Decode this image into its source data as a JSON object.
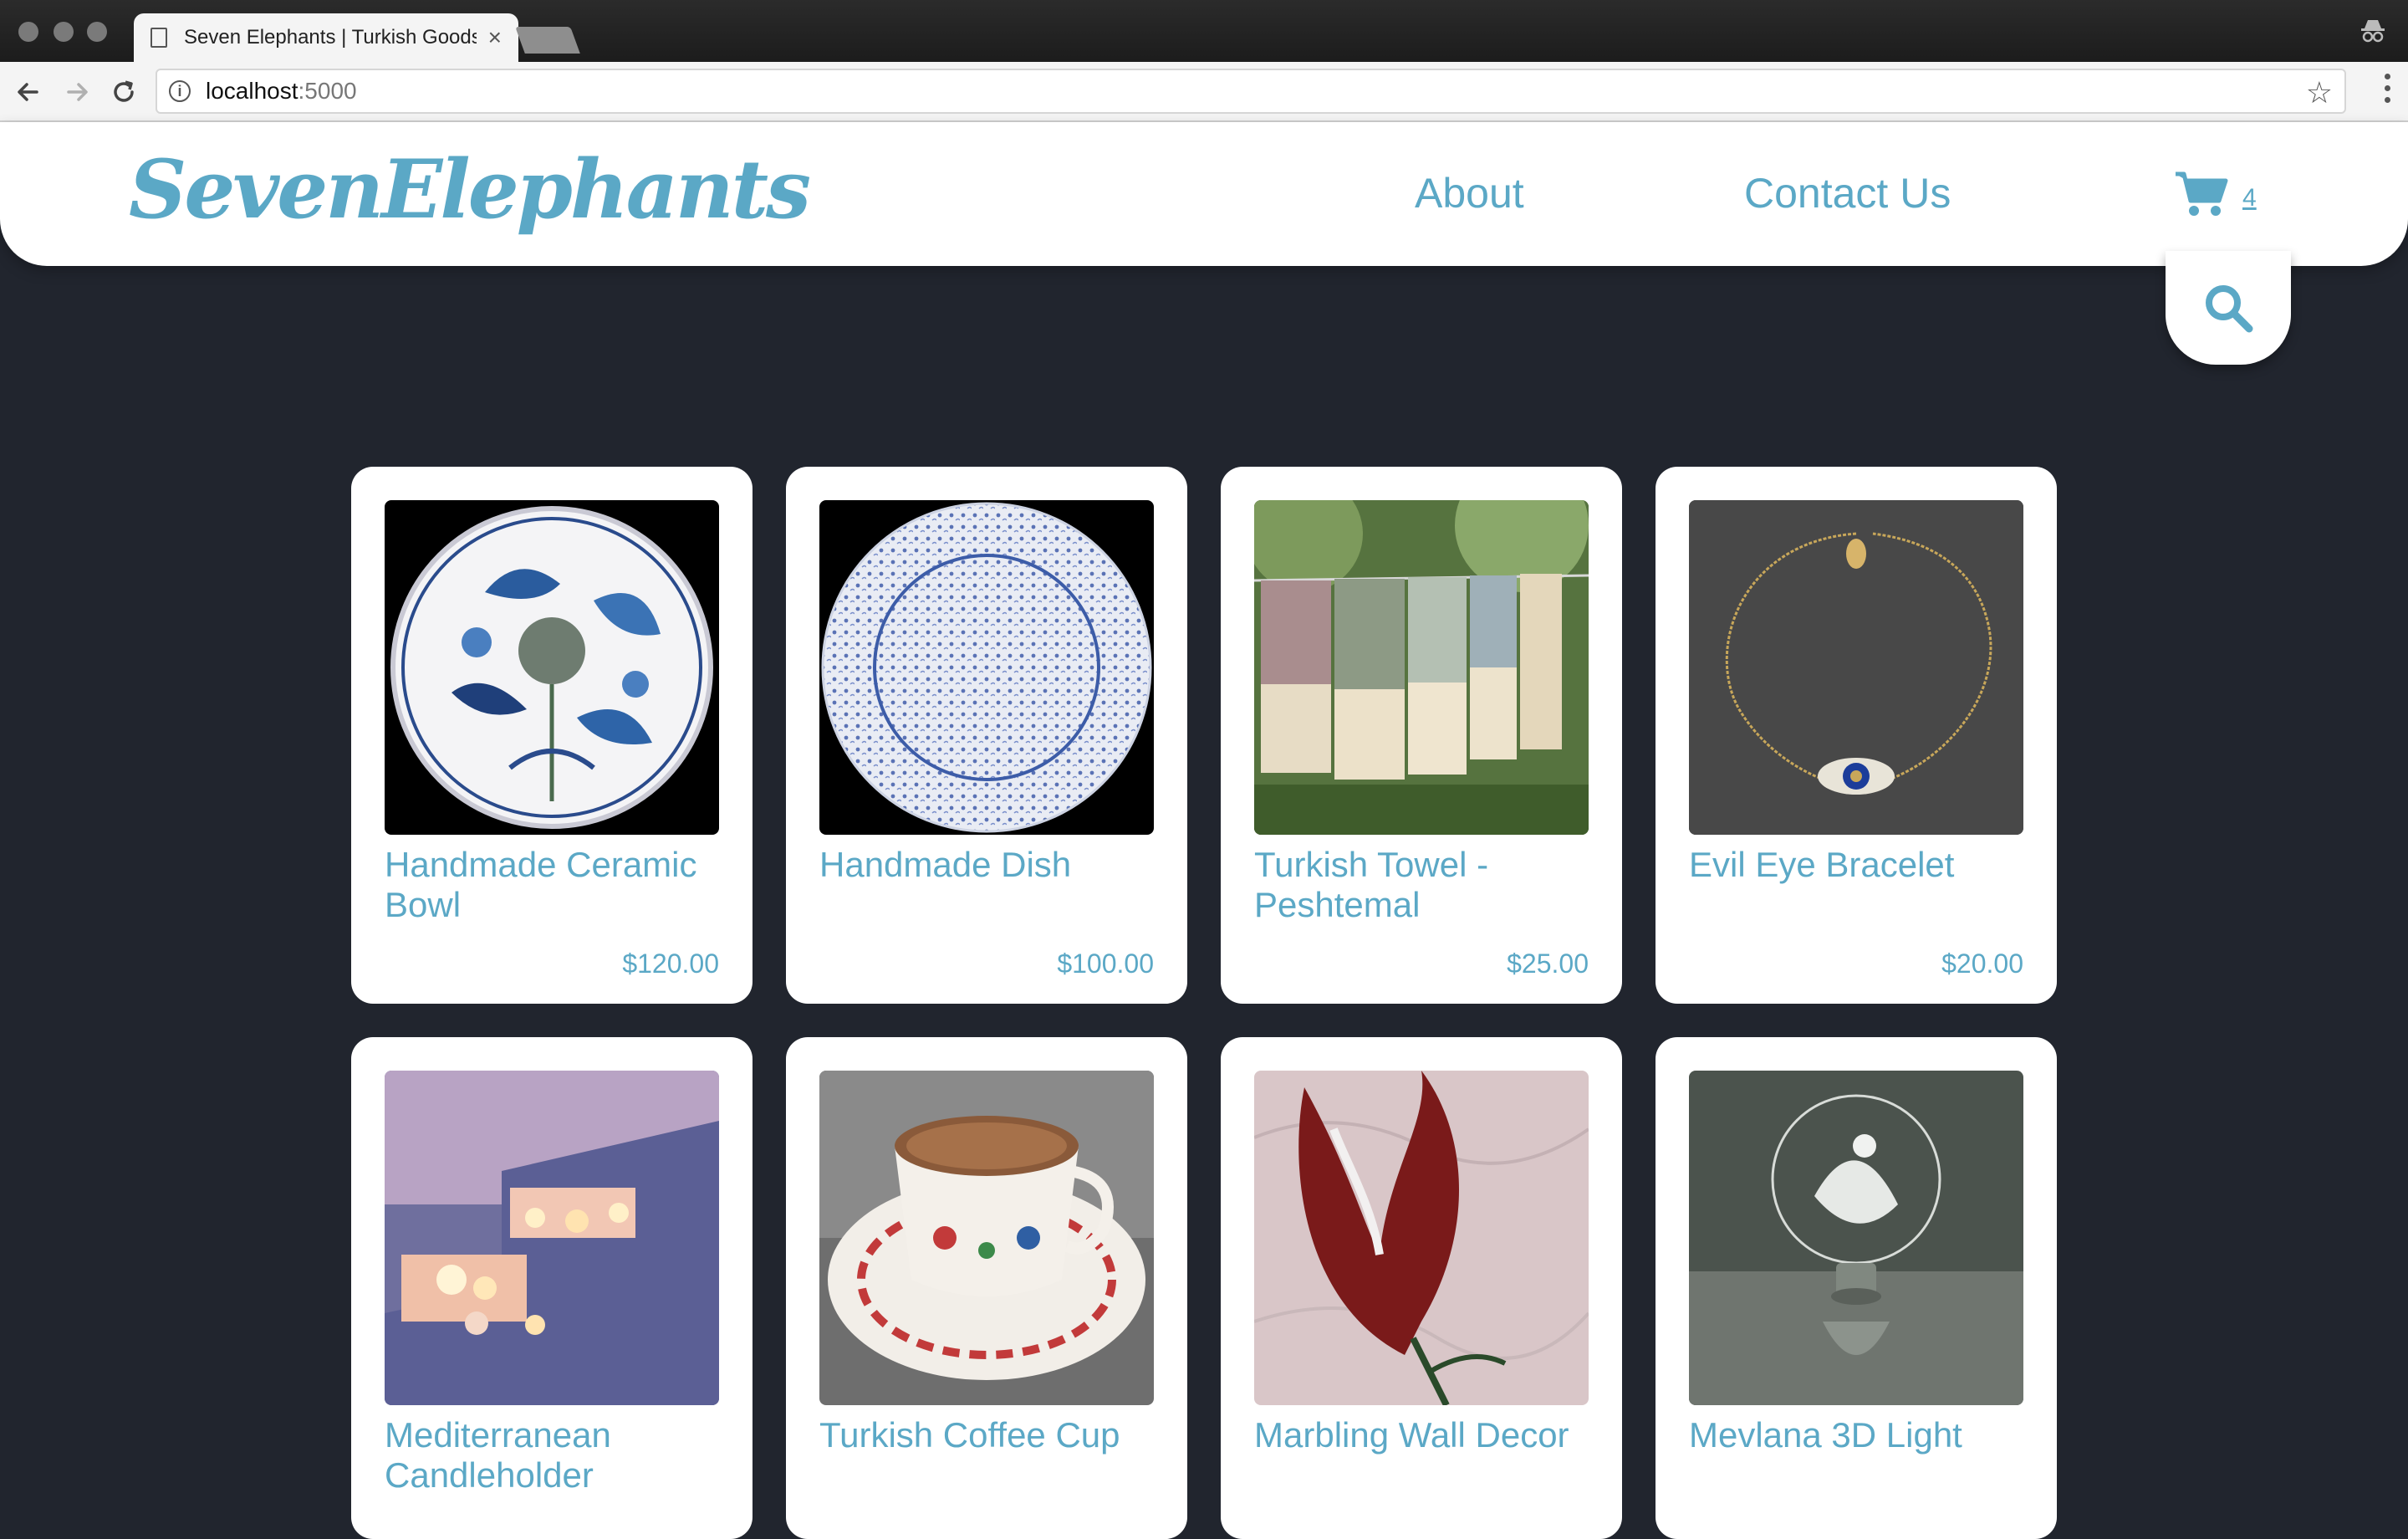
{
  "browser": {
    "tab_title": "Seven Elephants | Turkish Goods",
    "tab_close": "×",
    "url_host": "localhost",
    "url_port": ":5000",
    "star_glyph": "☆"
  },
  "site": {
    "logo": "SevenElephants",
    "nav": {
      "about": "About",
      "contact": "Contact Us"
    },
    "cart_count": "4",
    "accent_color": "#5ba8c6",
    "background_color": "#21252e"
  },
  "products": [
    {
      "name": "Handmade Ceramic Bowl",
      "price": "$120.00"
    },
    {
      "name": "Handmade Dish",
      "price": "$100.00"
    },
    {
      "name": "Turkish Towel - Peshtemal",
      "price": "$25.00"
    },
    {
      "name": "Evil Eye Bracelet",
      "price": "$20.00"
    },
    {
      "name": "Mediterranean Candleholder"
    },
    {
      "name": "Turkish Coffee Cup"
    },
    {
      "name": "Marbling Wall Decor"
    },
    {
      "name": "Mevlana 3D Light"
    }
  ]
}
